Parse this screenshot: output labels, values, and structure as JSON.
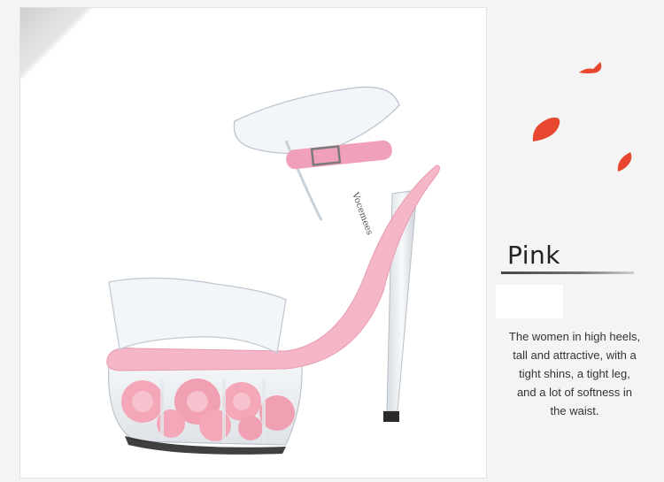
{
  "product": {
    "brand_imprint": "Vocemees",
    "color_name": "Pink",
    "description": "The women in high heels, tall and attractive, with a tight shins, a tight leg, and a lot of softness in the waist."
  },
  "colors": {
    "accent_pink": "#f5b7c8",
    "rose": "#f3a7b8",
    "petal_red": "#e8462e",
    "text": "#333333"
  }
}
